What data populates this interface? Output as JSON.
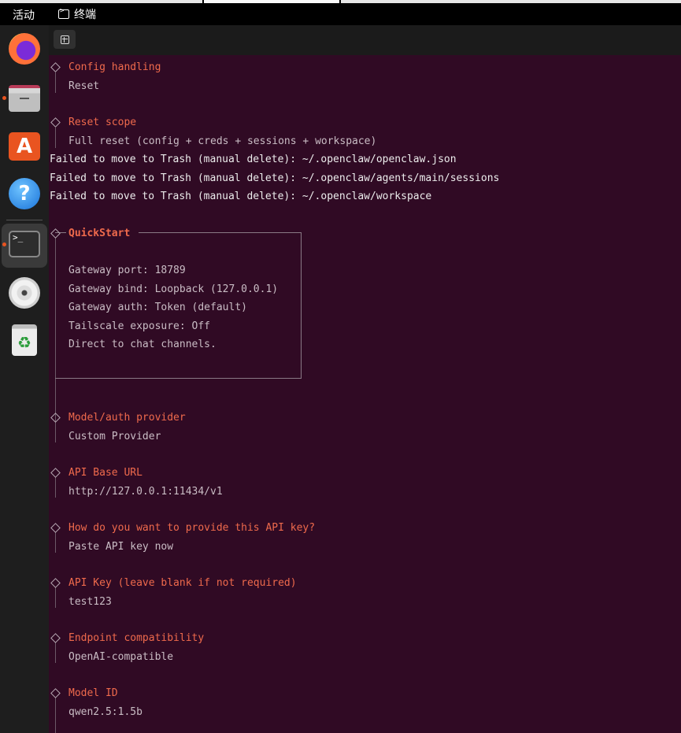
{
  "topbar": {
    "activities": "活动",
    "app_name": "终端"
  },
  "dock": {
    "items": [
      {
        "name": "firefox-icon"
      },
      {
        "name": "files-icon"
      },
      {
        "name": "app-store-icon",
        "glyph": "A"
      },
      {
        "name": "help-icon",
        "glyph": "?"
      },
      {
        "name": "terminal-icon",
        "glyph": ">_"
      },
      {
        "name": "disc-icon"
      },
      {
        "name": "trash-icon",
        "glyph": "♻"
      }
    ],
    "running_dot_color": "#e95420"
  },
  "terminal": {
    "background": "#300a24",
    "prompt_color": "#ef6a4c",
    "sections": [
      {
        "prompt": "Config handling",
        "answer": "Reset"
      },
      {
        "prompt": "Reset scope",
        "answer": "Full reset (config + creds + sessions + workspace)"
      }
    ],
    "failures": [
      "Failed to move to Trash (manual delete): ~/.openclaw/openclaw.json",
      "Failed to move to Trash (manual delete): ~/.openclaw/agents/main/sessions",
      "Failed to move to Trash (manual delete): ~/.openclaw/workspace"
    ],
    "quickstart": {
      "title": "QuickStart",
      "lines": [
        "Gateway port: 18789",
        "Gateway bind: Loopback (127.0.0.1)",
        "Gateway auth: Token (default)",
        "Tailscale exposure: Off",
        "Direct to chat channels."
      ]
    },
    "questions": [
      {
        "prompt": "Model/auth provider",
        "answer": "Custom Provider"
      },
      {
        "prompt": "API Base URL",
        "answer": "http://127.0.0.1:11434/v1"
      },
      {
        "prompt": "How do you want to provide this API key?",
        "answer": "Paste API key now"
      },
      {
        "prompt": "API Key (leave blank if not required)",
        "answer": "test123"
      },
      {
        "prompt": "Endpoint compatibility",
        "answer": "OpenAI-compatible"
      },
      {
        "prompt": "Model ID",
        "answer": "qwen2.5:1.5b"
      }
    ]
  }
}
